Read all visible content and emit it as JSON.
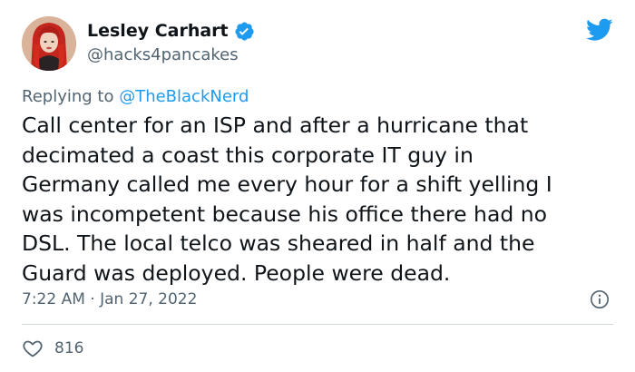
{
  "author": {
    "display_name": "Lesley Carhart",
    "handle": "@hacks4pancakes",
    "verified": true
  },
  "reply": {
    "prefix": "Replying to ",
    "mention": "@TheBlackNerd"
  },
  "tweet": {
    "lines": [
      "Call center for an ISP and after a hurricane that",
      "decimated a coast this corporate IT guy in",
      "Germany called me every hour for a shift yelling I",
      "was incompetent because his office there had no",
      "DSL. The local telco was sheared in half and the",
      "Guard was deployed. People were dead."
    ]
  },
  "meta": {
    "time": "7:22 AM",
    "separator": " · ",
    "date": "Jan 27, 2022"
  },
  "engagement": {
    "likes": "816"
  },
  "icons": {
    "logo": "twitter-bird-icon",
    "verified": "verified-badge-icon",
    "info": "info-icon",
    "like": "heart-icon"
  },
  "colors": {
    "brand": "#1d9bf0",
    "text": "#0f1419",
    "muted": "#536471",
    "divider": "#cfd9de"
  }
}
